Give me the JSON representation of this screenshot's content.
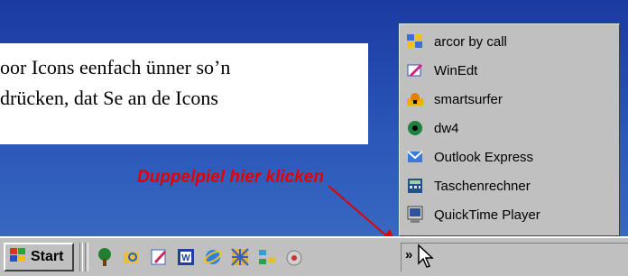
{
  "document": {
    "line1": "oor Icons eenfach ünner so’n",
    "line2": "drücken, dat Se an de Icons"
  },
  "annotation": {
    "text": "Duppelpiel hier klicken",
    "color": "#e30000"
  },
  "menu": {
    "items": [
      {
        "label": "arcor by call",
        "icon": "arcor-icon"
      },
      {
        "label": "WinEdt",
        "icon": "winedt-icon"
      },
      {
        "label": "smartsurfer",
        "icon": "smartsurfer-icon"
      },
      {
        "label": "dw4",
        "icon": "dw4-icon"
      },
      {
        "label": "Outlook Express",
        "icon": "outlook-express-icon"
      },
      {
        "label": "Taschenrechner",
        "icon": "calculator-icon"
      },
      {
        "label": "QuickTime Player",
        "icon": "quicktime-icon"
      }
    ]
  },
  "taskbar": {
    "start_label": "Start",
    "quick_launch": [
      "tree-icon",
      "folder-search-icon",
      "notepad-icon",
      "word-icon",
      "internet-explorer-icon",
      "grid-app-icon",
      "network-app-icon",
      "media-app-icon"
    ],
    "chevron": "»"
  },
  "colors": {
    "desktop": "#2a56b8",
    "taskbar": "#c0c0c0",
    "annotation": "#e30000"
  }
}
